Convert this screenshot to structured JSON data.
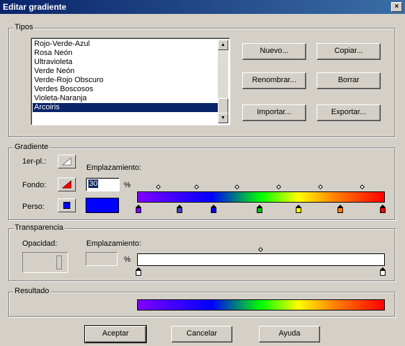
{
  "window": {
    "title": "Editar gradiente",
    "close_glyph": "×"
  },
  "tipos": {
    "legend": "Tipos",
    "items": [
      "Rojo-Verde-Azul",
      "Rosa Neón",
      "Ultravioleta",
      "Verde Neón",
      "Verde-Rojo Obscuro",
      "Verdes Boscosos",
      "Violeta-Naranja",
      "Arcoiris"
    ],
    "selected": "Arcoiris",
    "buttons": {
      "nuevo": "Nuevo...",
      "copiar": "Copiar...",
      "renombrar": "Renombrar...",
      "borrar": "Borrar",
      "importar": "Importar...",
      "exportar": "Exportar..."
    }
  },
  "gradiente": {
    "legend": "Gradiente",
    "primer_label": "1er-pl.:",
    "fondo_label": "Fondo:",
    "perso_label": "Perso:",
    "emplazamiento_label": "Emplazamiento:",
    "emplazamiento_value": "30",
    "percent": "%",
    "perso_color": "#0000ff",
    "stop_colors": [
      "#8000ff",
      "#4040c0",
      "#0000ff",
      "#00c000",
      "#ffff00",
      "#ff8000",
      "#ff0000"
    ]
  },
  "transparencia": {
    "legend": "Transparencia",
    "opacidad_label": "Opacidad:",
    "emplazamiento_label": "Emplazamiento:",
    "percent": "%"
  },
  "resultado": {
    "legend": "Resultado"
  },
  "footer": {
    "aceptar": "Aceptar",
    "cancelar": "Cancelar",
    "ayuda": "Ayuda"
  }
}
